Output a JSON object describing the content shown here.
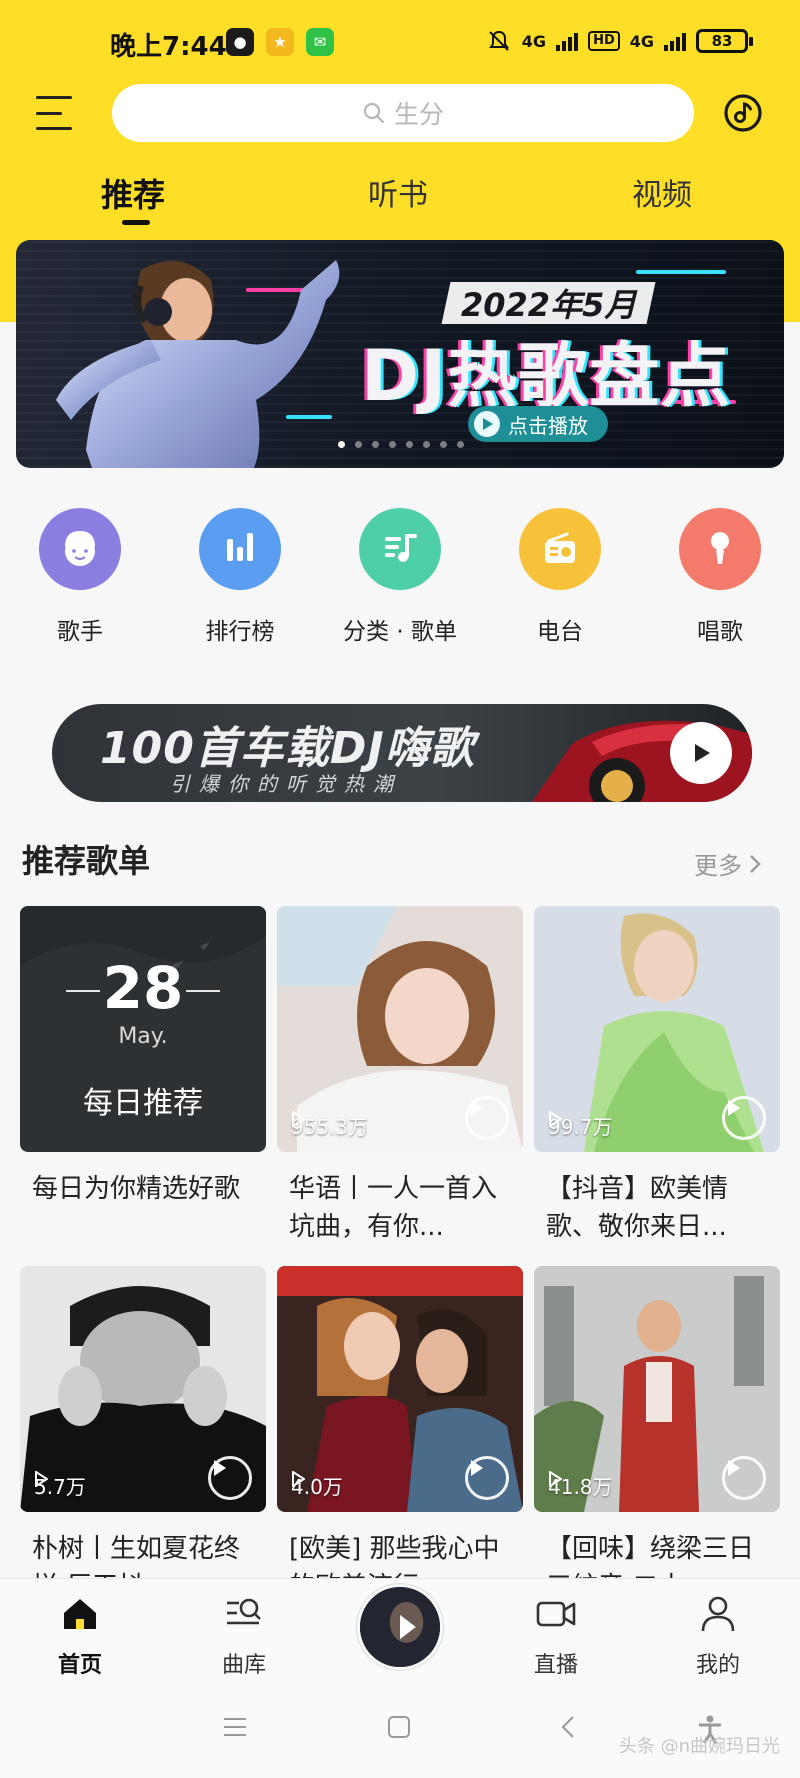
{
  "status_bar": {
    "time": "晚上7:44",
    "network_1": "4G",
    "hd": "HD",
    "network_2": "4G",
    "battery": "83"
  },
  "header": {
    "search_placeholder": "生分"
  },
  "tabs": [
    {
      "label": "推荐",
      "active": true
    },
    {
      "label": "听书",
      "active": false
    },
    {
      "label": "视频",
      "active": false
    }
  ],
  "banner": {
    "year_label": "2022年5月",
    "title": "DJ热歌盘点",
    "cta": "点击播放",
    "dots": 8,
    "active_dot": 0
  },
  "quick_entries": [
    {
      "label": "歌手",
      "icon": "singer-icon",
      "color": "#8a7ee0"
    },
    {
      "label": "排行榜",
      "icon": "chart-bars-icon",
      "color": "#5b9df0"
    },
    {
      "label": "分类 · 歌单",
      "icon": "playlist-icon",
      "color": "#4fcfa7"
    },
    {
      "label": "电台",
      "icon": "radio-icon",
      "color": "#f8c13a"
    },
    {
      "label": "唱歌",
      "icon": "microphone-icon",
      "color": "#f47a6b"
    }
  ],
  "promo": {
    "title": "100首车载DJ嗨歌",
    "subtitle": "引爆你的听觉热潮"
  },
  "section": {
    "title": "推荐歌单",
    "more": "更多"
  },
  "daily_card": {
    "day": "28",
    "month": "May.",
    "label": "每日推荐"
  },
  "playlists": [
    {
      "title": "每日为你精选好歌",
      "plays": ""
    },
    {
      "title": "华语丨一人一首入坑曲，有你...",
      "plays": "955.3万"
    },
    {
      "title": "【抖音】欧美情歌、敬你来日...",
      "plays": "99.7万"
    },
    {
      "title": "朴树丨生如夏花终样 巨天抖",
      "plays": "5.7万"
    },
    {
      "title": "[欧美] 那些我心中的欧美流行",
      "plays": "4.0万"
    },
    {
      "title": "【回味】绕梁三日 三絃音 二十",
      "plays": "41.8万"
    }
  ],
  "bottom_nav": [
    {
      "label": "首页",
      "icon": "home-icon",
      "active": true
    },
    {
      "label": "曲库",
      "icon": "library-search-icon",
      "active": false
    },
    {
      "label": "直播",
      "icon": "live-camera-icon",
      "active": false
    },
    {
      "label": "我的",
      "icon": "profile-icon",
      "active": false
    }
  ],
  "watermark": "头条 @n曲婉玛日光"
}
